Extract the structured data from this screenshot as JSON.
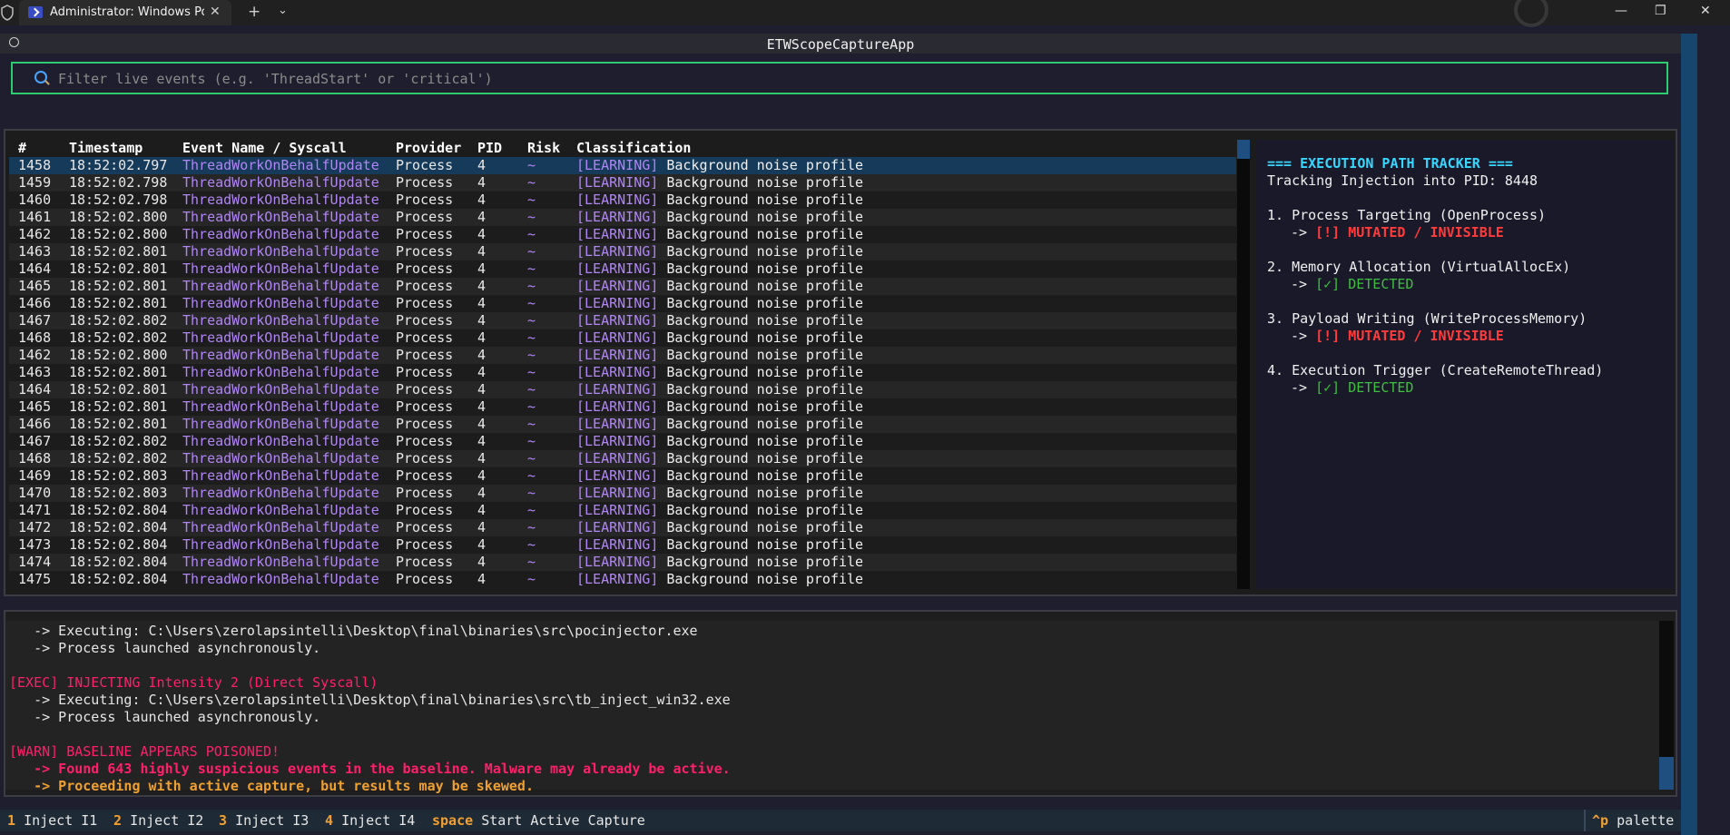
{
  "window": {
    "tab_title": "Administrator: Windows PowerShell",
    "tab_close": "✕",
    "new_tab": "+",
    "tab_dropdown": "⌄",
    "minimize": "—",
    "maximize": "❐",
    "close": "✕"
  },
  "app": {
    "title": "ETWScopeCaptureApp"
  },
  "filter": {
    "placeholder": "Filter live events (e.g. 'ThreadStart' or 'critical')",
    "value": ""
  },
  "events": {
    "headers": [
      "#",
      "Timestamp",
      "Event Name / Syscall",
      "Provider",
      "PID",
      "Risk",
      "Classification"
    ],
    "rows": [
      {
        "num": "1458",
        "ts": "18:52:02.797",
        "event": "ThreadWorkOnBehalfUpdate",
        "provider": "Process",
        "pid": "4",
        "risk": "~",
        "tag": "[LEARNING]",
        "msg": "Background noise profile"
      },
      {
        "num": "1459",
        "ts": "18:52:02.798",
        "event": "ThreadWorkOnBehalfUpdate",
        "provider": "Process",
        "pid": "4",
        "risk": "~",
        "tag": "[LEARNING]",
        "msg": "Background noise profile"
      },
      {
        "num": "1460",
        "ts": "18:52:02.798",
        "event": "ThreadWorkOnBehalfUpdate",
        "provider": "Process",
        "pid": "4",
        "risk": "~",
        "tag": "[LEARNING]",
        "msg": "Background noise profile"
      },
      {
        "num": "1461",
        "ts": "18:52:02.800",
        "event": "ThreadWorkOnBehalfUpdate",
        "provider": "Process",
        "pid": "4",
        "risk": "~",
        "tag": "[LEARNING]",
        "msg": "Background noise profile"
      },
      {
        "num": "1462",
        "ts": "18:52:02.800",
        "event": "ThreadWorkOnBehalfUpdate",
        "provider": "Process",
        "pid": "4",
        "risk": "~",
        "tag": "[LEARNING]",
        "msg": "Background noise profile"
      },
      {
        "num": "1463",
        "ts": "18:52:02.801",
        "event": "ThreadWorkOnBehalfUpdate",
        "provider": "Process",
        "pid": "4",
        "risk": "~",
        "tag": "[LEARNING]",
        "msg": "Background noise profile"
      },
      {
        "num": "1464",
        "ts": "18:52:02.801",
        "event": "ThreadWorkOnBehalfUpdate",
        "provider": "Process",
        "pid": "4",
        "risk": "~",
        "tag": "[LEARNING]",
        "msg": "Background noise profile"
      },
      {
        "num": "1465",
        "ts": "18:52:02.801",
        "event": "ThreadWorkOnBehalfUpdate",
        "provider": "Process",
        "pid": "4",
        "risk": "~",
        "tag": "[LEARNING]",
        "msg": "Background noise profile"
      },
      {
        "num": "1466",
        "ts": "18:52:02.801",
        "event": "ThreadWorkOnBehalfUpdate",
        "provider": "Process",
        "pid": "4",
        "risk": "~",
        "tag": "[LEARNING]",
        "msg": "Background noise profile"
      },
      {
        "num": "1467",
        "ts": "18:52:02.802",
        "event": "ThreadWorkOnBehalfUpdate",
        "provider": "Process",
        "pid": "4",
        "risk": "~",
        "tag": "[LEARNING]",
        "msg": "Background noise profile"
      },
      {
        "num": "1468",
        "ts": "18:52:02.802",
        "event": "ThreadWorkOnBehalfUpdate",
        "provider": "Process",
        "pid": "4",
        "risk": "~",
        "tag": "[LEARNING]",
        "msg": "Background noise profile"
      },
      {
        "num": "1462",
        "ts": "18:52:02.800",
        "event": "ThreadWorkOnBehalfUpdate",
        "provider": "Process",
        "pid": "4",
        "risk": "~",
        "tag": "[LEARNING]",
        "msg": "Background noise profile"
      },
      {
        "num": "1463",
        "ts": "18:52:02.801",
        "event": "ThreadWorkOnBehalfUpdate",
        "provider": "Process",
        "pid": "4",
        "risk": "~",
        "tag": "[LEARNING]",
        "msg": "Background noise profile"
      },
      {
        "num": "1464",
        "ts": "18:52:02.801",
        "event": "ThreadWorkOnBehalfUpdate",
        "provider": "Process",
        "pid": "4",
        "risk": "~",
        "tag": "[LEARNING]",
        "msg": "Background noise profile"
      },
      {
        "num": "1465",
        "ts": "18:52:02.801",
        "event": "ThreadWorkOnBehalfUpdate",
        "provider": "Process",
        "pid": "4",
        "risk": "~",
        "tag": "[LEARNING]",
        "msg": "Background noise profile"
      },
      {
        "num": "1466",
        "ts": "18:52:02.801",
        "event": "ThreadWorkOnBehalfUpdate",
        "provider": "Process",
        "pid": "4",
        "risk": "~",
        "tag": "[LEARNING]",
        "msg": "Background noise profile"
      },
      {
        "num": "1467",
        "ts": "18:52:02.802",
        "event": "ThreadWorkOnBehalfUpdate",
        "provider": "Process",
        "pid": "4",
        "risk": "~",
        "tag": "[LEARNING]",
        "msg": "Background noise profile"
      },
      {
        "num": "1468",
        "ts": "18:52:02.802",
        "event": "ThreadWorkOnBehalfUpdate",
        "provider": "Process",
        "pid": "4",
        "risk": "~",
        "tag": "[LEARNING]",
        "msg": "Background noise profile"
      },
      {
        "num": "1469",
        "ts": "18:52:02.803",
        "event": "ThreadWorkOnBehalfUpdate",
        "provider": "Process",
        "pid": "4",
        "risk": "~",
        "tag": "[LEARNING]",
        "msg": "Background noise profile"
      },
      {
        "num": "1470",
        "ts": "18:52:02.803",
        "event": "ThreadWorkOnBehalfUpdate",
        "provider": "Process",
        "pid": "4",
        "risk": "~",
        "tag": "[LEARNING]",
        "msg": "Background noise profile"
      },
      {
        "num": "1471",
        "ts": "18:52:02.804",
        "event": "ThreadWorkOnBehalfUpdate",
        "provider": "Process",
        "pid": "4",
        "risk": "~",
        "tag": "[LEARNING]",
        "msg": "Background noise profile"
      },
      {
        "num": "1472",
        "ts": "18:52:02.804",
        "event": "ThreadWorkOnBehalfUpdate",
        "provider": "Process",
        "pid": "4",
        "risk": "~",
        "tag": "[LEARNING]",
        "msg": "Background noise profile"
      },
      {
        "num": "1473",
        "ts": "18:52:02.804",
        "event": "ThreadWorkOnBehalfUpdate",
        "provider": "Process",
        "pid": "4",
        "risk": "~",
        "tag": "[LEARNING]",
        "msg": "Background noise profile"
      },
      {
        "num": "1474",
        "ts": "18:52:02.804",
        "event": "ThreadWorkOnBehalfUpdate",
        "provider": "Process",
        "pid": "4",
        "risk": "~",
        "tag": "[LEARNING]",
        "msg": "Background noise profile"
      },
      {
        "num": "1475",
        "ts": "18:52:02.804",
        "event": "ThreadWorkOnBehalfUpdate",
        "provider": "Process",
        "pid": "4",
        "risk": "~",
        "tag": "[LEARNING]",
        "msg": "Background noise profile"
      }
    ]
  },
  "tracker": {
    "title": "=== EXECUTION PATH TRACKER ===",
    "subtitle": "Tracking Injection into PID: 8448",
    "arrow": "->",
    "steps": [
      {
        "label": "1. Process Targeting (OpenProcess)",
        "status": "[!] MUTATED / INVISIBLE",
        "state": "mutated"
      },
      {
        "label": "2. Memory Allocation (VirtualAllocEx)",
        "status": "[✓] DETECTED",
        "state": "detected"
      },
      {
        "label": "3. Payload Writing (WriteProcessMemory)",
        "status": "[!] MUTATED / INVISIBLE",
        "state": "mutated"
      },
      {
        "label": "4. Execution Trigger (CreateRemoteThread)",
        "status": "[✓] DETECTED",
        "state": "detected"
      }
    ]
  },
  "log": {
    "lines": [
      {
        "text": "   -> Executing: C:\\Users\\zerolapsintelli\\Desktop\\final\\binaries\\src\\pocinjector.exe",
        "style": "normal"
      },
      {
        "text": "   -> Process launched asynchronously.",
        "style": "normal"
      },
      {
        "text": "",
        "style": "normal"
      },
      {
        "text": "[EXEC] INJECTING Intensity 2 (Direct Syscall)",
        "style": "exec"
      },
      {
        "text": "   -> Executing: C:\\Users\\zerolapsintelli\\Desktop\\final\\binaries\\src\\tb_inject_win32.exe",
        "style": "normal"
      },
      {
        "text": "   -> Process launched asynchronously.",
        "style": "normal"
      },
      {
        "text": "",
        "style": "normal"
      },
      {
        "text": "[WARN] BASELINE APPEARS POISONED!",
        "style": "warn"
      },
      {
        "text": "   -> Found 643 highly suspicious events in the baseline. Malware may already be active.",
        "style": "warn-bold"
      },
      {
        "text": "   -> Proceeding with active capture, but results may be skewed.",
        "style": "orange"
      }
    ]
  },
  "footer": {
    "items": [
      {
        "key": "1",
        "label": "Inject I1"
      },
      {
        "key": "2",
        "label": "Inject I2"
      },
      {
        "key": "3",
        "label": "Inject I3"
      },
      {
        "key": "4",
        "label": "Inject I4"
      },
      {
        "key": "space",
        "label": "Start Active Capture"
      }
    ],
    "palette_key": "^p",
    "palette_label": "palette"
  },
  "colors": {
    "accent_border": "#2ecc71",
    "event_purple": "#b085f5",
    "mutated_red": "#ff3b3b",
    "detected_green": "#3fbf3f",
    "exec_pink": "#ff1f6a",
    "warn_orange": "#f0a030",
    "tracker_title": "#38d7ff"
  }
}
